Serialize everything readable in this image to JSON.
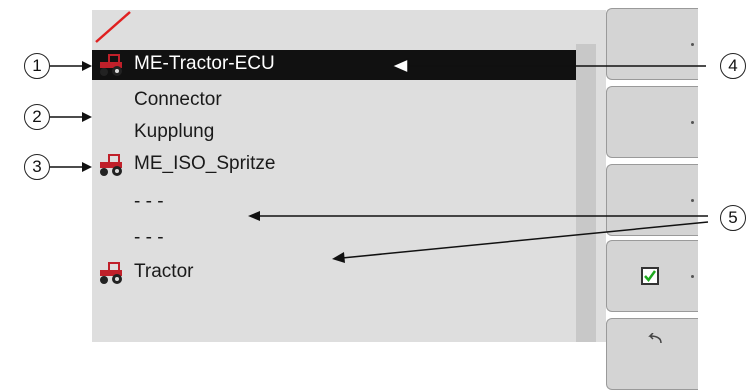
{
  "list": {
    "rows": [
      {
        "label": "ME-Tractor-ECU",
        "icon": "tractor-icon",
        "selected": true
      },
      {
        "label": "Connector",
        "icon": "",
        "selected": false
      },
      {
        "label": "Kupplung",
        "icon": "",
        "selected": false
      },
      {
        "label": "ME_ISO_Spritze",
        "icon": "tractor-icon",
        "selected": false
      },
      {
        "label": "- - -",
        "icon": "",
        "selected": false
      },
      {
        "label": "- - -",
        "icon": "",
        "selected": false
      },
      {
        "label": "Tractor",
        "icon": "tractor-icon",
        "selected": false
      }
    ]
  },
  "softkeys": [
    {
      "icon": ""
    },
    {
      "icon": ""
    },
    {
      "icon": ""
    },
    {
      "icon": "checkbox-icon"
    },
    {
      "icon": "back-icon"
    }
  ],
  "callouts": [
    "1",
    "2",
    "3",
    "4",
    "5"
  ],
  "colors": {
    "selected_row": "#111111",
    "tractor_red": "#c0202a",
    "status_slash": "#e02020",
    "checkmark": "#1faa1f"
  }
}
